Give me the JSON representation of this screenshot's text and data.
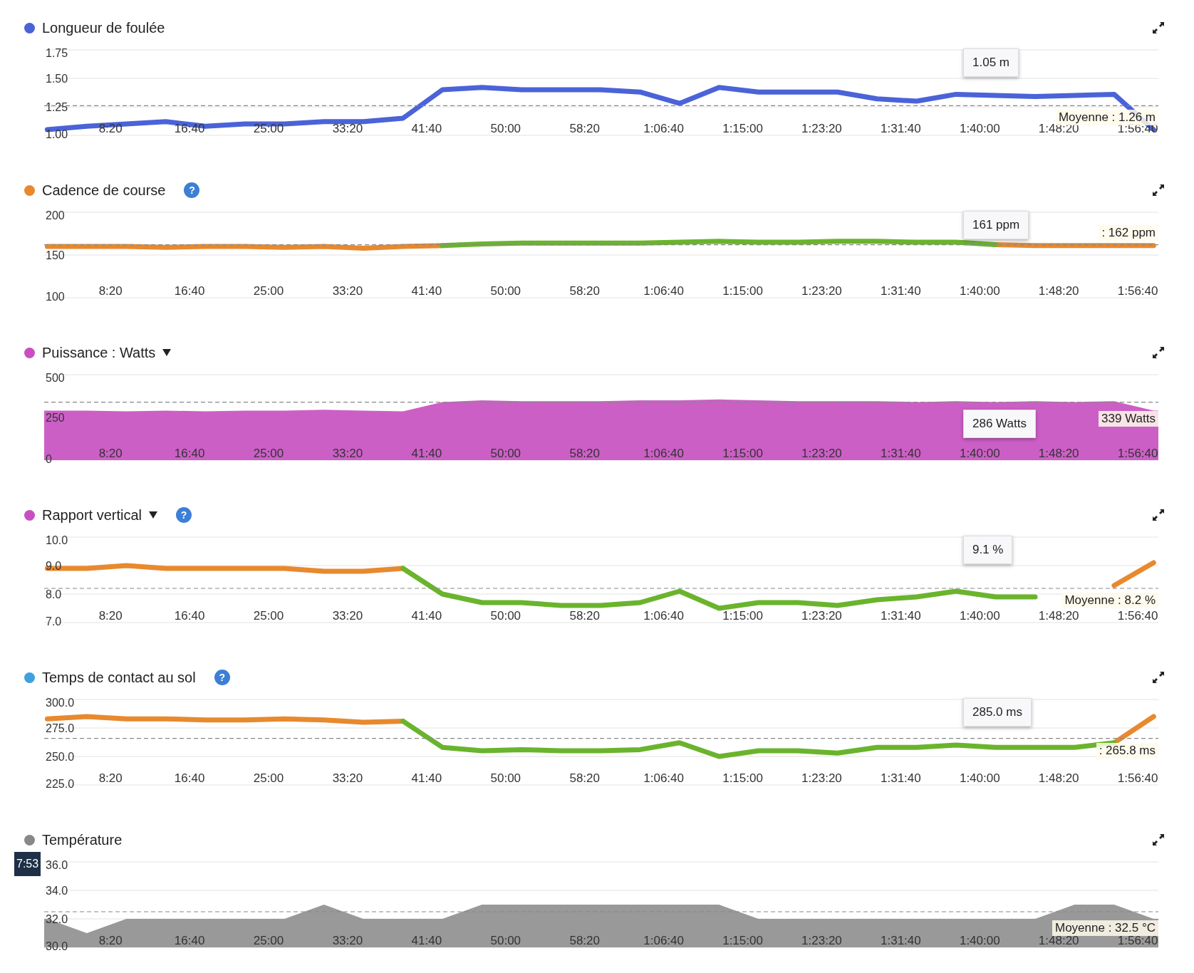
{
  "panels": [
    {
      "title": "Longueur de foulée",
      "color": "#4a63d8",
      "tooltip": "1.05 m",
      "chart_data": {
        "type": "line",
        "x": [
          100,
          350,
          600,
          850,
          1100,
          1350,
          1600,
          1850,
          2100,
          2350,
          2600,
          2850,
          3100,
          3350,
          3600,
          3850,
          4100,
          4350,
          4600,
          4850,
          5100,
          5350,
          5600,
          5850,
          6100,
          6350,
          6600,
          6850,
          7100
        ],
        "xlim": [
          80,
          7130
        ],
        "ylim": [
          1,
          1.75
        ],
        "series": [
          {
            "color": "#4a63d8",
            "values": [
              1.05,
              1.08,
              1.1,
              1.12,
              1.08,
              1.1,
              1.1,
              1.12,
              1.12,
              1.15,
              1.4,
              1.42,
              1.4,
              1.4,
              1.4,
              1.38,
              1.28,
              1.42,
              1.38,
              1.38,
              1.38,
              1.32,
              1.3,
              1.36,
              1.35,
              1.34,
              1.35,
              1.36,
              1.05
            ]
          }
        ],
        "xticks": [
          {
            "value": 500,
            "label": "8:20"
          },
          {
            "value": 1000,
            "label": "16:40"
          },
          {
            "value": 1500,
            "label": "25:00"
          },
          {
            "value": 2000,
            "label": "33:20"
          },
          {
            "value": 2500,
            "label": "41:40"
          },
          {
            "value": 3000,
            "label": "50:00"
          },
          {
            "value": 3500,
            "label": "58:20"
          },
          {
            "value": 4000,
            "label": "1:06:40"
          },
          {
            "value": 4500,
            "label": "1:15:00"
          },
          {
            "value": 5000,
            "label": "1:23:20"
          },
          {
            "value": 5500,
            "label": "1:31:40"
          },
          {
            "value": 6000,
            "label": "1:40:00"
          },
          {
            "value": 6500,
            "label": "1:48:20"
          },
          {
            "value": 7000,
            "label": "1:56:40"
          }
        ],
        "yticks": [
          {
            "value": 1,
            "label": "1.00"
          },
          {
            "value": 1.25,
            "label": "1.25"
          },
          {
            "value": 1.5,
            "label": "1.50"
          },
          {
            "value": 1.75,
            "label": "1.75"
          }
        ],
        "ref_lines": [
          {
            "axis": "y",
            "value": 1.26,
            "label": "Moyenne : 1.26 m"
          }
        ]
      }
    },
    {
      "title": "Cadence de course",
      "color": "#e8892e",
      "help": "?",
      "tooltip": "161 ppm",
      "chart_data": {
        "type": "line",
        "x": [
          100,
          350,
          600,
          850,
          1100,
          1350,
          1600,
          1850,
          2100,
          2350,
          2600,
          2850,
          3100,
          3350,
          3600,
          3850,
          4100,
          4350,
          4600,
          4850,
          5100,
          5350,
          5600,
          5850,
          6100,
          6350,
          6600,
          6850,
          7100
        ],
        "xlim": [
          80,
          7130
        ],
        "ylim": [
          100,
          200
        ],
        "series": [
          {
            "color": "#e8892e",
            "values": [
              160,
              160,
              160,
              159,
              160,
              160,
              159,
              160,
              158,
              160,
              161,
              null,
              null,
              null,
              null,
              null,
              null,
              null,
              null,
              null,
              null,
              null,
              null,
              null,
              162,
              161,
              161,
              161,
              161
            ]
          },
          {
            "color": "#6ab42d",
            "values": [
              null,
              null,
              null,
              null,
              null,
              null,
              null,
              null,
              null,
              null,
              161,
              163,
              164,
              164,
              164,
              164,
              165,
              166,
              165,
              165,
              166,
              166,
              165,
              165,
              162,
              null,
              null,
              null,
              null
            ]
          }
        ],
        "xticks": [
          {
            "value": 500,
            "label": "8:20"
          },
          {
            "value": 1000,
            "label": "16:40"
          },
          {
            "value": 1500,
            "label": "25:00"
          },
          {
            "value": 2000,
            "label": "33:20"
          },
          {
            "value": 2500,
            "label": "41:40"
          },
          {
            "value": 3000,
            "label": "50:00"
          },
          {
            "value": 3500,
            "label": "58:20"
          },
          {
            "value": 4000,
            "label": "1:06:40"
          },
          {
            "value": 4500,
            "label": "1:15:00"
          },
          {
            "value": 5000,
            "label": "1:23:20"
          },
          {
            "value": 5500,
            "label": "1:31:40"
          },
          {
            "value": 6000,
            "label": "1:40:00"
          },
          {
            "value": 6500,
            "label": "1:48:20"
          },
          {
            "value": 7000,
            "label": "1:56:40"
          }
        ],
        "yticks": [
          {
            "value": 100,
            "label": "100"
          },
          {
            "value": 150,
            "label": "150"
          },
          {
            "value": 200,
            "label": "200"
          }
        ],
        "ref_lines": [
          {
            "axis": "y",
            "value": 162,
            "label": ": 162 ppm"
          }
        ]
      }
    },
    {
      "title": "Puissance : Watts",
      "color": "#c94fc0",
      "dropdown": true,
      "tooltip": "286 Watts",
      "chart_data": {
        "type": "area",
        "x": [
          100,
          350,
          600,
          850,
          1100,
          1350,
          1600,
          1850,
          2100,
          2350,
          2600,
          2850,
          3100,
          3350,
          3600,
          3850,
          4100,
          4350,
          4600,
          4850,
          5100,
          5350,
          5600,
          5850,
          6100,
          6350,
          6600,
          6850,
          7100
        ],
        "xlim": [
          80,
          7130
        ],
        "ylim": [
          0,
          500
        ],
        "series": [
          {
            "color": "#cc5fc6",
            "values": [
              290,
              290,
              285,
              290,
              285,
              290,
              290,
              295,
              290,
              285,
              340,
              350,
              345,
              345,
              345,
              350,
              350,
              355,
              350,
              345,
              345,
              345,
              340,
              345,
              340,
              345,
              340,
              345,
              290
            ]
          }
        ],
        "xticks": [
          {
            "value": 500,
            "label": "8:20"
          },
          {
            "value": 1000,
            "label": "16:40"
          },
          {
            "value": 1500,
            "label": "25:00"
          },
          {
            "value": 2000,
            "label": "33:20"
          },
          {
            "value": 2500,
            "label": "41:40"
          },
          {
            "value": 3000,
            "label": "50:00"
          },
          {
            "value": 3500,
            "label": "58:20"
          },
          {
            "value": 4000,
            "label": "1:06:40"
          },
          {
            "value": 4500,
            "label": "1:15:00"
          },
          {
            "value": 5000,
            "label": "1:23:20"
          },
          {
            "value": 5500,
            "label": "1:31:40"
          },
          {
            "value": 6000,
            "label": "1:40:00"
          },
          {
            "value": 6500,
            "label": "1:48:20"
          },
          {
            "value": 7000,
            "label": "1:56:40"
          }
        ],
        "yticks": [
          {
            "value": 0,
            "label": "0"
          },
          {
            "value": 250,
            "label": "250"
          },
          {
            "value": 500,
            "label": "500"
          }
        ],
        "ref_lines": [
          {
            "axis": "y",
            "value": 339,
            "label": "339 Watts"
          }
        ]
      }
    },
    {
      "title": "Rapport vertical",
      "color": "#c94fc0",
      "dropdown": true,
      "help": "?",
      "tooltip": "9.1 %",
      "chart_data": {
        "type": "line",
        "x": [
          100,
          350,
          600,
          850,
          1100,
          1350,
          1600,
          1850,
          2100,
          2350,
          2600,
          2850,
          3100,
          3350,
          3600,
          3850,
          4100,
          4350,
          4600,
          4850,
          5100,
          5350,
          5600,
          5850,
          6100,
          6350,
          6600,
          6850,
          7100
        ],
        "xlim": [
          80,
          7130
        ],
        "ylim": [
          7,
          10
        ],
        "series": [
          {
            "color": "#e8892e",
            "values": [
              8.9,
              8.9,
              9,
              8.9,
              8.9,
              8.9,
              8.9,
              8.8,
              8.8,
              8.9,
              null,
              null,
              null,
              null,
              null,
              null,
              null,
              null,
              null,
              null,
              null,
              null,
              null,
              null,
              null,
              null,
              null,
              8.3,
              9.1
            ]
          },
          {
            "color": "#6ab42d",
            "values": [
              null,
              null,
              null,
              null,
              null,
              null,
              null,
              null,
              null,
              8.9,
              8,
              7.7,
              7.7,
              7.6,
              7.6,
              7.7,
              8.1,
              7.5,
              7.7,
              7.7,
              7.6,
              7.8,
              7.9,
              8.1,
              7.9,
              7.9,
              null,
              null,
              null
            ]
          }
        ],
        "xticks": [
          {
            "value": 500,
            "label": "8:20"
          },
          {
            "value": 1000,
            "label": "16:40"
          },
          {
            "value": 1500,
            "label": "25:00"
          },
          {
            "value": 2000,
            "label": "33:20"
          },
          {
            "value": 2500,
            "label": "41:40"
          },
          {
            "value": 3000,
            "label": "50:00"
          },
          {
            "value": 3500,
            "label": "58:20"
          },
          {
            "value": 4000,
            "label": "1:06:40"
          },
          {
            "value": 4500,
            "label": "1:15:00"
          },
          {
            "value": 5000,
            "label": "1:23:20"
          },
          {
            "value": 5500,
            "label": "1:31:40"
          },
          {
            "value": 6000,
            "label": "1:40:00"
          },
          {
            "value": 6500,
            "label": "1:48:20"
          },
          {
            "value": 7000,
            "label": "1:56:40"
          }
        ],
        "yticks": [
          {
            "value": 7,
            "label": "7.0"
          },
          {
            "value": 8,
            "label": "8.0"
          },
          {
            "value": 9,
            "label": "9.0"
          },
          {
            "value": 10,
            "label": "10.0"
          }
        ],
        "ref_lines": [
          {
            "axis": "y",
            "value": 8.2,
            "label": "Moyenne : 8.2 %"
          }
        ]
      }
    },
    {
      "title": "Temps de contact au sol",
      "color": "#3fa0e0",
      "help": "?",
      "tooltip": "285.0 ms",
      "chart_data": {
        "type": "line",
        "x": [
          100,
          350,
          600,
          850,
          1100,
          1350,
          1600,
          1850,
          2100,
          2350,
          2600,
          2850,
          3100,
          3350,
          3600,
          3850,
          4100,
          4350,
          4600,
          4850,
          5100,
          5350,
          5600,
          5850,
          6100,
          6350,
          6600,
          6850,
          7100
        ],
        "xlim": [
          80,
          7130
        ],
        "ylim": [
          225,
          300
        ],
        "series": [
          {
            "color": "#e8892e",
            "values": [
              283,
              285,
              283,
              283,
              282,
              282,
              283,
              282,
              280,
              281,
              null,
              null,
              null,
              null,
              null,
              null,
              null,
              null,
              null,
              null,
              null,
              null,
              null,
              null,
              null,
              null,
              null,
              262,
              285
            ]
          },
          {
            "color": "#6ab42d",
            "values": [
              null,
              null,
              null,
              null,
              null,
              null,
              null,
              null,
              null,
              281,
              258,
              255,
              256,
              255,
              255,
              256,
              262,
              250,
              255,
              255,
              253,
              258,
              258,
              260,
              258,
              258,
              258,
              262,
              null
            ]
          }
        ],
        "xticks": [
          {
            "value": 500,
            "label": "8:20"
          },
          {
            "value": 1000,
            "label": "16:40"
          },
          {
            "value": 1500,
            "label": "25:00"
          },
          {
            "value": 2000,
            "label": "33:20"
          },
          {
            "value": 2500,
            "label": "41:40"
          },
          {
            "value": 3000,
            "label": "50:00"
          },
          {
            "value": 3500,
            "label": "58:20"
          },
          {
            "value": 4000,
            "label": "1:06:40"
          },
          {
            "value": 4500,
            "label": "1:15:00"
          },
          {
            "value": 5000,
            "label": "1:23:20"
          },
          {
            "value": 5500,
            "label": "1:31:40"
          },
          {
            "value": 6000,
            "label": "1:40:00"
          },
          {
            "value": 6500,
            "label": "1:48:20"
          },
          {
            "value": 7000,
            "label": "1:56:40"
          }
        ],
        "yticks": [
          {
            "value": 225,
            "label": "225.0"
          },
          {
            "value": 250,
            "label": "250.0"
          },
          {
            "value": 275,
            "label": "275.0"
          },
          {
            "value": 300,
            "label": "300.0"
          }
        ],
        "ref_lines": [
          {
            "axis": "y",
            "value": 265.8,
            "label": ": 265.8 ms"
          }
        ]
      }
    },
    {
      "title": "Température",
      "color": "#888888",
      "badge": "7:53",
      "chart_data": {
        "type": "area",
        "x": [
          100,
          350,
          600,
          850,
          1100,
          1350,
          1600,
          1850,
          2100,
          2350,
          2600,
          2850,
          3100,
          3350,
          3600,
          3850,
          4100,
          4350,
          4600,
          4850,
          5100,
          5350,
          5600,
          5850,
          6100,
          6350,
          6600,
          6850,
          7100
        ],
        "xlim": [
          80,
          7130
        ],
        "ylim": [
          30,
          36
        ],
        "series": [
          {
            "color": "#999999",
            "values": [
              32,
              31,
              32,
              32,
              32,
              32,
              32,
              33,
              32,
              32,
              32,
              33,
              33,
              33,
              33,
              33,
              33,
              33,
              32,
              32,
              32,
              32,
              32,
              32,
              32,
              32,
              33,
              33,
              32
            ]
          }
        ],
        "xticks": [
          {
            "value": 500,
            "label": "8:20"
          },
          {
            "value": 1000,
            "label": "16:40"
          },
          {
            "value": 1500,
            "label": "25:00"
          },
          {
            "value": 2000,
            "label": "33:20"
          },
          {
            "value": 2500,
            "label": "41:40"
          },
          {
            "value": 3000,
            "label": "50:00"
          },
          {
            "value": 3500,
            "label": "58:20"
          },
          {
            "value": 4000,
            "label": "1:06:40"
          },
          {
            "value": 4500,
            "label": "1:15:00"
          },
          {
            "value": 5000,
            "label": "1:23:20"
          },
          {
            "value": 5500,
            "label": "1:31:40"
          },
          {
            "value": 6000,
            "label": "1:40:00"
          },
          {
            "value": 6500,
            "label": "1:48:20"
          },
          {
            "value": 7000,
            "label": "1:56:40"
          }
        ],
        "yticks": [
          {
            "value": 30,
            "label": "30.0"
          },
          {
            "value": 32,
            "label": "32.0"
          },
          {
            "value": 34,
            "label": "34.0"
          },
          {
            "value": 36,
            "label": "36.0"
          }
        ],
        "ref_lines": [
          {
            "axis": "y",
            "value": 32.5,
            "label": "Moyenne : 32.5 °C"
          }
        ]
      }
    }
  ]
}
